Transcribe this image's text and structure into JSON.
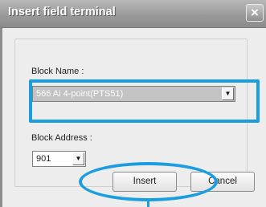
{
  "dialog": {
    "title": "Insert field terminal",
    "close_glyph": "×"
  },
  "block_name": {
    "label": "Block Name :",
    "selected_value": "566  Ai 4-point(PTS51)"
  },
  "block_address": {
    "label": "Block Address :",
    "selected_value": "901"
  },
  "buttons": {
    "insert_label": "Insert",
    "cancel_label": "Cancel"
  },
  "colors": {
    "highlight": "#1a9ee0",
    "title_bar": "#9a9a9a"
  }
}
